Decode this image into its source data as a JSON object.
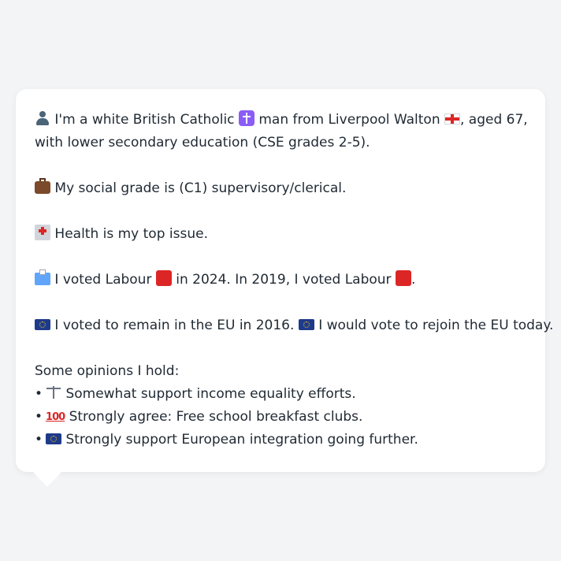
{
  "message": {
    "identity": {
      "part1": "I'm a white British Catholic",
      "part2": "man from Liverpool Walton",
      "part3": ", aged 67,",
      "line2": "with lower secondary education (CSE grades 2-5)."
    },
    "social_grade": "My social grade is (C1) supervisory/clerical.",
    "top_issue": "Health is my top issue.",
    "vote": {
      "part1": "I voted Labour",
      "part2": "in 2024. In 2019, I voted Labour",
      "part3": "."
    },
    "eu": {
      "part1": "I voted to remain in the EU in 2016.",
      "part2": "I would vote to rejoin the EU today."
    },
    "opinions": {
      "heading": "Some opinions I hold:",
      "items": [
        "Somewhat support income equality efforts.",
        "Strongly agree: Free school breakfast clubs.",
        "Strongly support European integration going further."
      ],
      "icon_100_label": "100"
    }
  },
  "icons": [
    "person-icon",
    "latin-cross-icon",
    "england-flag-icon",
    "briefcase-icon",
    "hospital-icon",
    "ballot-box-icon",
    "red-square-icon",
    "eu-flag-icon",
    "scales-icon",
    "hundred-points-icon"
  ],
  "colors": {
    "background": "#f3f4f6",
    "card": "#ffffff",
    "text": "#1f2933",
    "labour_red": "#dc2626",
    "eu_blue": "#1e3a8a"
  }
}
